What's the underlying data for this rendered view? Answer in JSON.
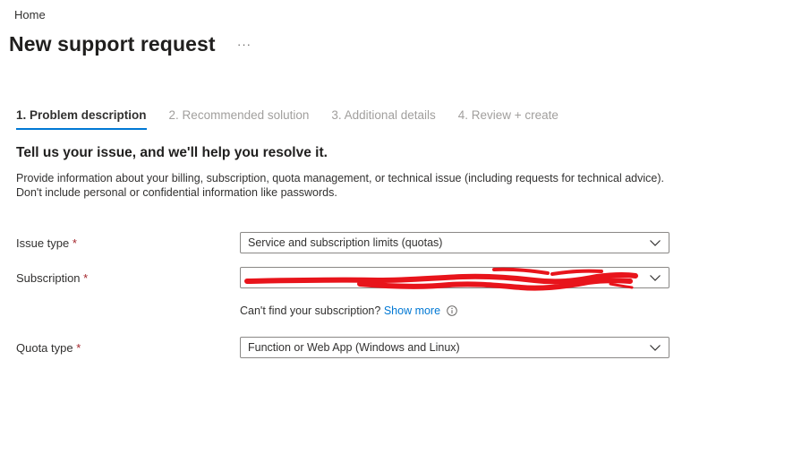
{
  "breadcrumb": {
    "home": "Home"
  },
  "page": {
    "title": "New support request",
    "more": "···"
  },
  "tabs": [
    {
      "label": "1. Problem description",
      "active": true
    },
    {
      "label": "2. Recommended solution",
      "active": false
    },
    {
      "label": "3. Additional details",
      "active": false
    },
    {
      "label": "4. Review + create",
      "active": false
    }
  ],
  "section": {
    "heading": "Tell us your issue, and we'll help you resolve it.",
    "description": "Provide information about your billing, subscription, quota management, or technical issue (including requests for technical advice). Don't include personal or confidential information like passwords."
  },
  "form": {
    "required_marker": "*",
    "issue_type": {
      "label": "Issue type",
      "value": "Service and subscription limits (quotas)"
    },
    "subscription": {
      "label": "Subscription",
      "value": ""
    },
    "helper": {
      "text": "Can't find your subscription?",
      "link": "Show more"
    },
    "quota_type": {
      "label": "Quota type",
      "value": "Function or Web App (Windows and Linux)"
    }
  },
  "colors": {
    "accent": "#0078d4",
    "required": "#a4262c",
    "redaction": "#e8141b"
  },
  "icons": [
    "chevron-down-icon",
    "info-icon"
  ]
}
